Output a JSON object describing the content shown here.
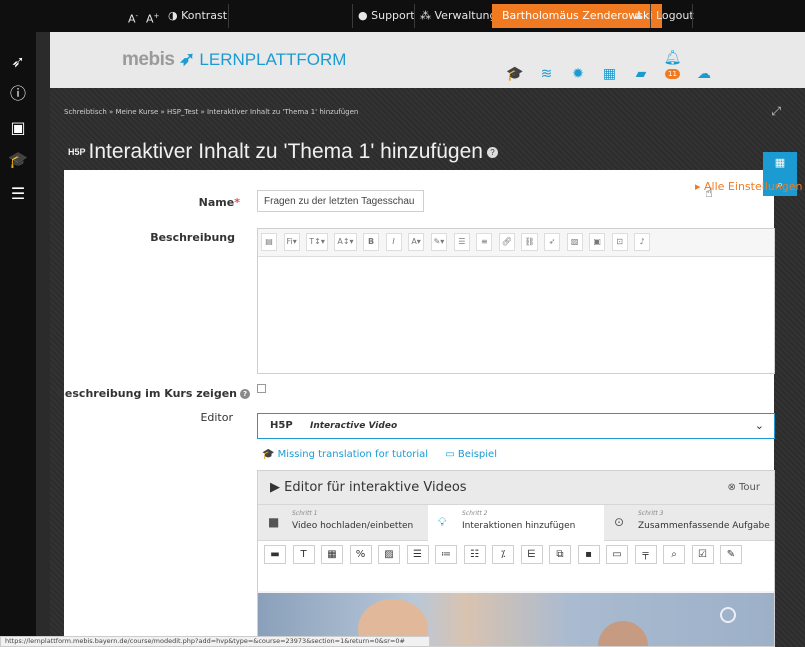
{
  "topbar": {
    "font_smaller": "A",
    "font_larger": "A",
    "contrast": "Kontrast",
    "support": "Support",
    "admin": "Verwaltung",
    "user": "Bartholomäus Zenderowski",
    "logout": "Logout"
  },
  "header": {
    "logo_main": "mebis",
    "logo_sub": "LERNPLATTFORM",
    "notification_count": "11"
  },
  "breadcrumb": "Schreibtisch » Meine Kurse » HSP_Test » Interaktiver Inhalt zu 'Thema 1' hinzufügen",
  "page": {
    "title_icon": "H5P",
    "title": "Interaktiver Inhalt zu 'Thema 1' hinzufügen"
  },
  "form": {
    "all_settings": "Alle Einstellungen",
    "name_label": "Name",
    "name_value": "Fragen zu der letzten Tagesschau",
    "description_label": "Beschreibung",
    "show_desc_label": "Beschreibung im Kurs zeigen",
    "editor_label": "Editor",
    "editor_logo": "H5P",
    "editor_selected": "Interactive Video",
    "link_tutorial": "Missing translation for tutorial",
    "link_example": "Beispiel"
  },
  "iv": {
    "title": "Editor für interaktive Videos",
    "tour": "Tour",
    "steps": [
      {
        "num": "Schritt 1",
        "label": "Video hochladen/einbetten"
      },
      {
        "num": "Schritt 2",
        "label": "Interaktionen hinzufügen"
      },
      {
        "num": "Schritt 3",
        "label": "Zusammenfassende Aufgabe"
      }
    ]
  },
  "statusbar": "https://lernplattform.mebis.bayern.de/course/modedit.php?add=hvp&type=&course=23973&section=1&return=0&sr=0#",
  "colors": {
    "accent": "#1b9bd1",
    "orange": "#f07a22"
  }
}
